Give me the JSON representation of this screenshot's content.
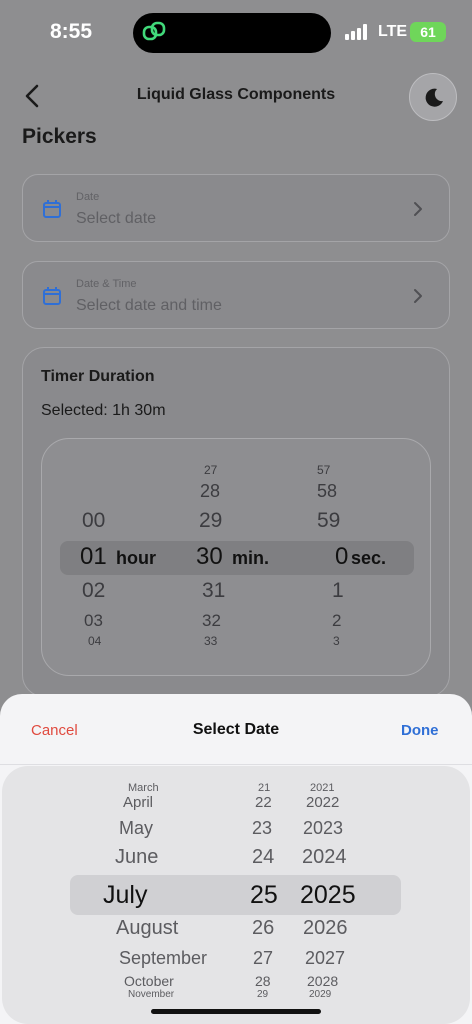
{
  "status": {
    "time": "8:55",
    "network": "LTE",
    "battery": "61"
  },
  "nav": {
    "title": "Liquid Glass Components"
  },
  "section": {
    "title": "Pickers"
  },
  "fields": [
    {
      "label": "Date",
      "placeholder": "Select date"
    },
    {
      "label": "Date & Time",
      "placeholder": "Select date and time"
    }
  ],
  "timer": {
    "title": "Timer Duration",
    "selected": "Selected: 1h 30m",
    "hours": [
      "00",
      "01",
      "02",
      "03",
      "04"
    ],
    "minutes": [
      "27",
      "28",
      "29",
      "30",
      "31",
      "32",
      "33"
    ],
    "seconds": [
      "57",
      "58",
      "59",
      "0",
      "1",
      "2",
      "3"
    ],
    "unit_hour": "hour",
    "unit_min": "min.",
    "unit_sec": "sec."
  },
  "sheet": {
    "cancel": "Cancel",
    "title": "Select Date",
    "done": "Done",
    "months": [
      "March",
      "April",
      "May",
      "June",
      "July",
      "August",
      "September",
      "October",
      "November"
    ],
    "days": [
      "21",
      "22",
      "23",
      "24",
      "25",
      "26",
      "27",
      "28",
      "29"
    ],
    "years": [
      "2021",
      "2022",
      "2023",
      "2024",
      "2025",
      "2026",
      "2027",
      "2028",
      "2029"
    ]
  },
  "colors": {
    "accent_blue": "#2f6fd6",
    "cancel_red": "#e04a3f",
    "battery_green": "#6fd65a"
  }
}
